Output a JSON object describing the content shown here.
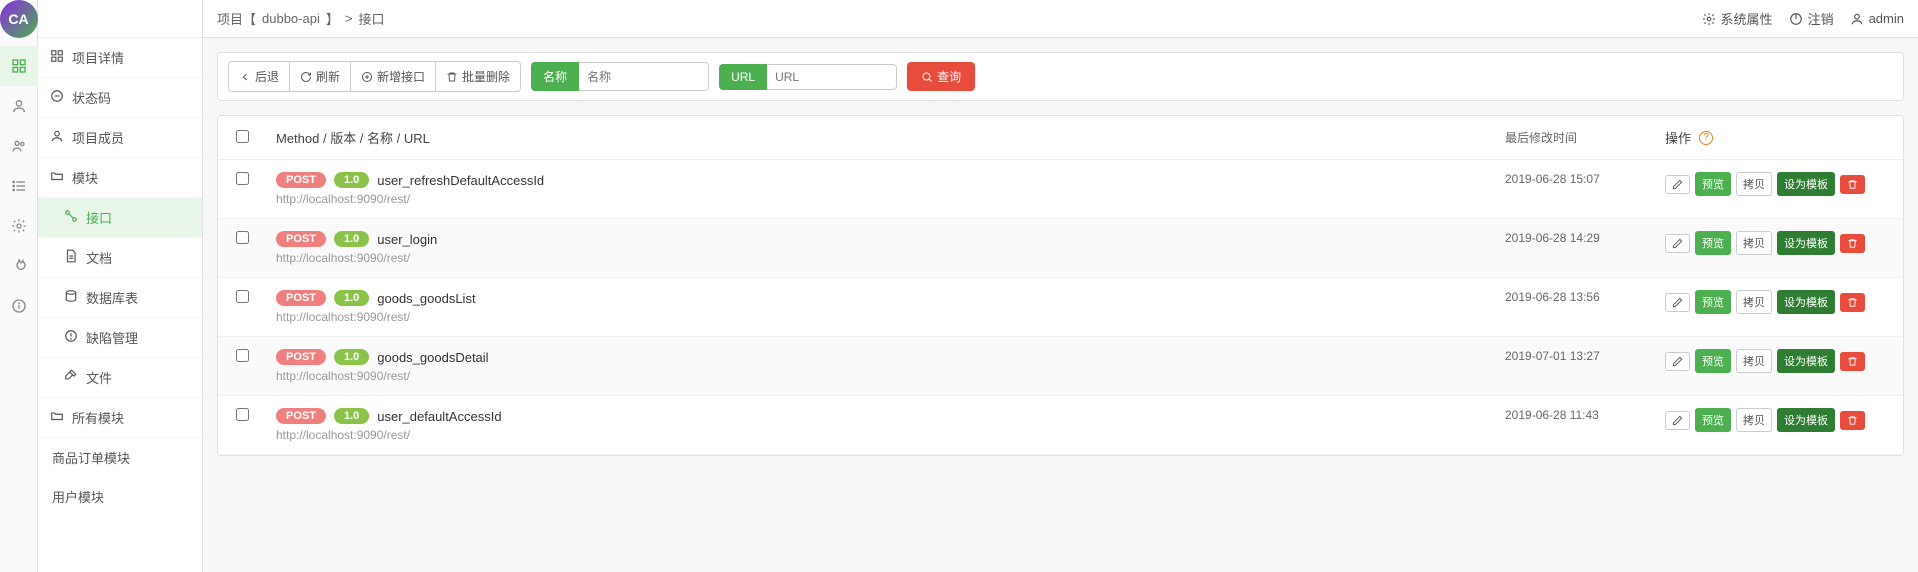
{
  "logo_text": "CA",
  "breadcrumb": {
    "prefix": "项目【",
    "project": "dubbo-api",
    "suffix": "】",
    "sep": ">",
    "page": "接口"
  },
  "header_links": {
    "system_props": "系统属性",
    "logout": "注销",
    "user": "admin"
  },
  "sidebar": {
    "items": [
      {
        "label": "项目详情"
      },
      {
        "label": "状态码"
      },
      {
        "label": "项目成员"
      },
      {
        "label": "模块"
      },
      {
        "label": "接口",
        "sub": true,
        "active": true
      },
      {
        "label": "文档",
        "sub": true
      },
      {
        "label": "数据库表",
        "sub": true
      },
      {
        "label": "缺陷管理",
        "sub": true
      },
      {
        "label": "文件",
        "sub": true
      },
      {
        "label": "所有模块"
      }
    ],
    "modules": [
      "商品订单模块",
      "用户模块"
    ]
  },
  "toolbar": {
    "back": "后退",
    "refresh": "刷新",
    "add_api": "新增接口",
    "batch_delete": "批量删除",
    "name_label": "名称",
    "name_placeholder": "名称",
    "url_label": "URL",
    "url_placeholder": "URL",
    "search": "查询"
  },
  "table": {
    "header": {
      "main": "Method / 版本 / 名称 / URL",
      "time": "最后修改时间",
      "ops": "操作"
    },
    "op_labels": {
      "preview": "预览",
      "copy": "拷贝",
      "set_template": "设为模板"
    },
    "rows": [
      {
        "method": "POST",
        "version": "1.0",
        "name": "user_refreshDefaultAccessId",
        "url": "http://localhost:9090/rest/",
        "time": "2019-06-28 15:07"
      },
      {
        "method": "POST",
        "version": "1.0",
        "name": "user_login",
        "url": "http://localhost:9090/rest/",
        "time": "2019-06-28 14:29"
      },
      {
        "method": "POST",
        "version": "1.0",
        "name": "goods_goodsList",
        "url": "http://localhost:9090/rest/",
        "time": "2019-06-28 13:56"
      },
      {
        "method": "POST",
        "version": "1.0",
        "name": "goods_goodsDetail",
        "url": "http://localhost:9090/rest/",
        "time": "2019-07-01 13:27"
      },
      {
        "method": "POST",
        "version": "1.0",
        "name": "user_defaultAccessId",
        "url": "http://localhost:9090/rest/",
        "time": "2019-06-28 11:43"
      }
    ]
  }
}
